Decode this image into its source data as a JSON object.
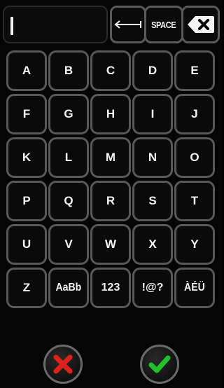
{
  "text_field": {
    "value": ""
  },
  "top_keys": {
    "cursor_move_icon": "left-right-arrow-icon",
    "space_label": "SPACE",
    "backspace_icon": "backspace-icon"
  },
  "keys": [
    {
      "label": "A"
    },
    {
      "label": "B"
    },
    {
      "label": "C"
    },
    {
      "label": "D"
    },
    {
      "label": "E"
    },
    {
      "label": "F"
    },
    {
      "label": "G"
    },
    {
      "label": "H"
    },
    {
      "label": "I"
    },
    {
      "label": "J"
    },
    {
      "label": "K"
    },
    {
      "label": "L"
    },
    {
      "label": "M"
    },
    {
      "label": "N"
    },
    {
      "label": "O"
    },
    {
      "label": "P"
    },
    {
      "label": "Q"
    },
    {
      "label": "R"
    },
    {
      "label": "S"
    },
    {
      "label": "T"
    },
    {
      "label": "U"
    },
    {
      "label": "V"
    },
    {
      "label": "W"
    },
    {
      "label": "X"
    },
    {
      "label": "Y"
    },
    {
      "label": "Z"
    },
    {
      "label": "AaBb"
    },
    {
      "label": "123"
    },
    {
      "label": "!@?"
    },
    {
      "label": "ÀÉÜ"
    }
  ],
  "actions": {
    "cancel_icon": "x-icon",
    "cancel_color": "#e0201a",
    "confirm_icon": "check-icon",
    "confirm_color": "#22c02a"
  }
}
